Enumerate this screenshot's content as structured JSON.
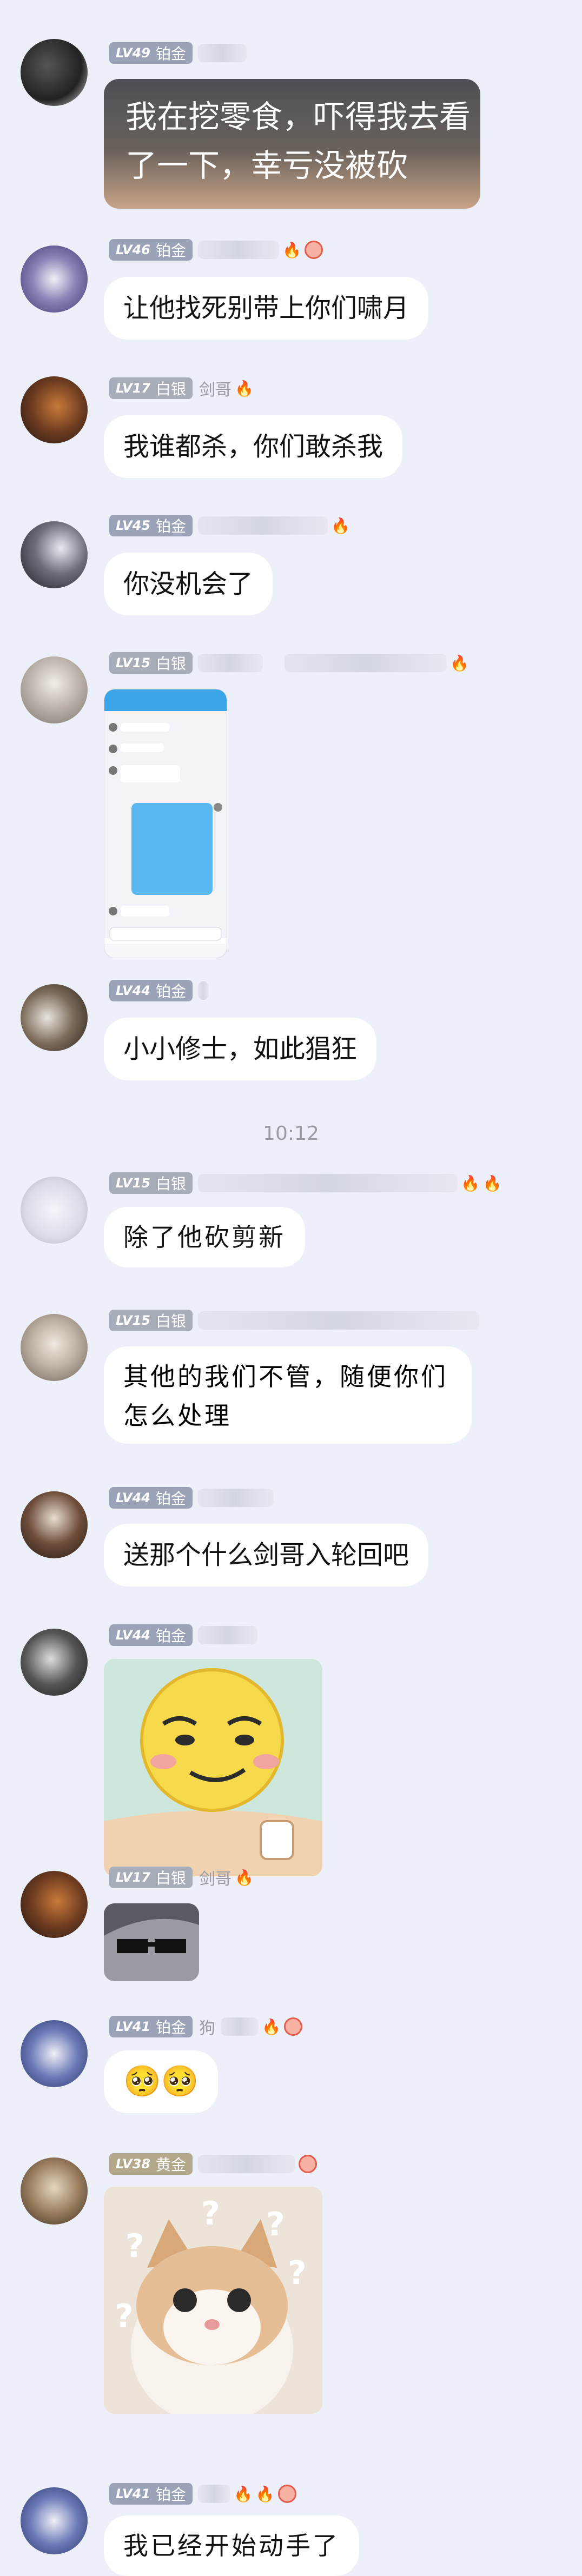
{
  "colors": {
    "background": "#eef0f9",
    "bubble": "#ffffff",
    "platinum_badge": "#9aa3b8",
    "silver_badge": "#a8adba",
    "gold_badge": "#b3a98a",
    "time": "#9a9ca4"
  },
  "messages": [
    {
      "level": "LV49",
      "rank": "铂金",
      "nick": "",
      "text_line1": "我在挖零食，吓得我去看",
      "text_line2": "了一下，幸亏没被砍"
    },
    {
      "level": "LV46",
      "rank": "铂金",
      "nick": "",
      "text": "让他找死别带上你们啸月"
    },
    {
      "level": "LV17",
      "rank": "白银",
      "nick": "剑哥",
      "text": "我谁都杀，你们敢杀我"
    },
    {
      "level": "LV45",
      "rank": "铂金",
      "nick": "",
      "text": "你没机会了"
    },
    {
      "level": "LV15",
      "rank": "白银",
      "nick": "",
      "image": "chat-screenshot"
    },
    {
      "level": "LV44",
      "rank": "铂金",
      "nick": "",
      "text": "小小修士，如此猖狂"
    },
    {
      "level": "LV15",
      "rank": "白银",
      "nick": "",
      "text": "除了他砍剪新"
    },
    {
      "level": "LV15",
      "rank": "白银",
      "nick": "",
      "text_line1": "其他的我们不管，随便你们",
      "text_line2": "怎么处理"
    },
    {
      "level": "LV44",
      "rank": "铂金",
      "nick": "",
      "text": "送那个什么剑哥入轮回吧"
    },
    {
      "level": "LV44",
      "rank": "铂金",
      "nick": "",
      "image": "smirk-sticker"
    },
    {
      "level": "LV17",
      "rank": "白银",
      "nick": "剑哥",
      "image": "sunglasses-sticker"
    },
    {
      "level": "LV41",
      "rank": "铂金",
      "nick": "狗",
      "emoji": "🥺🥺"
    },
    {
      "level": "LV38",
      "rank": "黄金",
      "nick": "",
      "image": "cat-question-sticker"
    },
    {
      "level": "LV41",
      "rank": "铂金",
      "nick": "",
      "text": "我已经开始动手了"
    }
  ],
  "timestamp": "10:12"
}
